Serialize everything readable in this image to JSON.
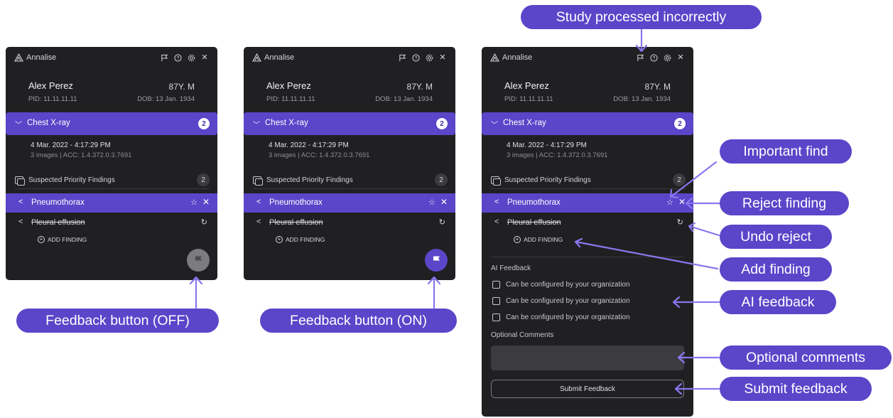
{
  "app": {
    "name": "Annalise"
  },
  "patient": {
    "name": "Alex Perez",
    "age_sex": "87Y. M",
    "pid": "PID: 11.11.11.11",
    "dob": "DOB: 13 Jan. 1934"
  },
  "study": {
    "label": "Chest X-ray",
    "count": "2",
    "date": "4 Mar. 2022 - 4:17:29 PM",
    "details": "3 images | ACC: 1.4.372.0.3.7691"
  },
  "priority": {
    "label": "Suspected Priority Findings",
    "count": "2"
  },
  "findings": {
    "active": "Pneumothorax",
    "rejected": "Pleural effusion",
    "add_label": "ADD FINDING"
  },
  "feedback": {
    "ai_title": "AI Feedback",
    "options": [
      "Can be configured by your organization",
      "Can be configured by your organization",
      "Can be configured by your organization"
    ],
    "comments_title": "Optional Comments",
    "submit_label": "Submit Feedback"
  },
  "icons": {
    "logo": "annalise-logo-icon",
    "flag": "flag-icon",
    "help": "help-icon",
    "settings": "gear-icon",
    "close": "close-icon",
    "star": "star-icon",
    "undo": "undo-icon",
    "chevron_down": "chevron-down-icon",
    "chevron_left": "chevron-left-icon",
    "add": "plus-circle-icon",
    "feedback": "flag-icon"
  },
  "colors": {
    "accent": "#5b45c9",
    "panel": "#202022",
    "feedback_off": "#7b7b80"
  },
  "callouts": {
    "study_incorrect": "Study processed incorrectly",
    "important_find": "Important find",
    "reject_finding": "Reject finding",
    "undo_reject": "Undo reject",
    "add_finding": "Add finding",
    "ai_feedback": "AI feedback",
    "optional_comments": "Optional comments",
    "submit_feedback": "Submit feedback",
    "feedback_off": "Feedback button (OFF)",
    "feedback_on": "Feedback button (ON)"
  }
}
